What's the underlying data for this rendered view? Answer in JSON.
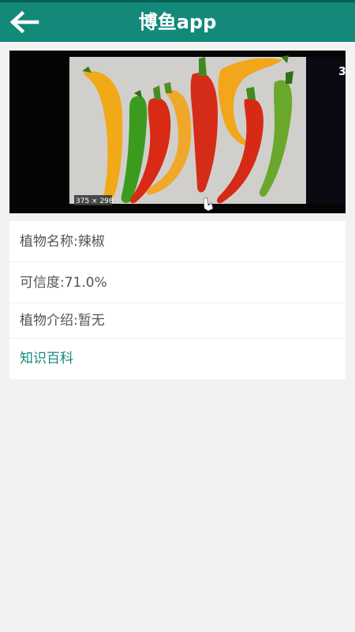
{
  "header": {
    "title": "博鱼app",
    "back_icon": "arrow-left-icon",
    "color": "#13897a"
  },
  "photo": {
    "caption": "375 × 298",
    "edge_text": "3"
  },
  "result": {
    "plant_name": "植物名称:辣椒",
    "confidence": "可信度:71.0%",
    "description": "植物介绍:暂无",
    "encyclopedia_link": "知识百科"
  }
}
